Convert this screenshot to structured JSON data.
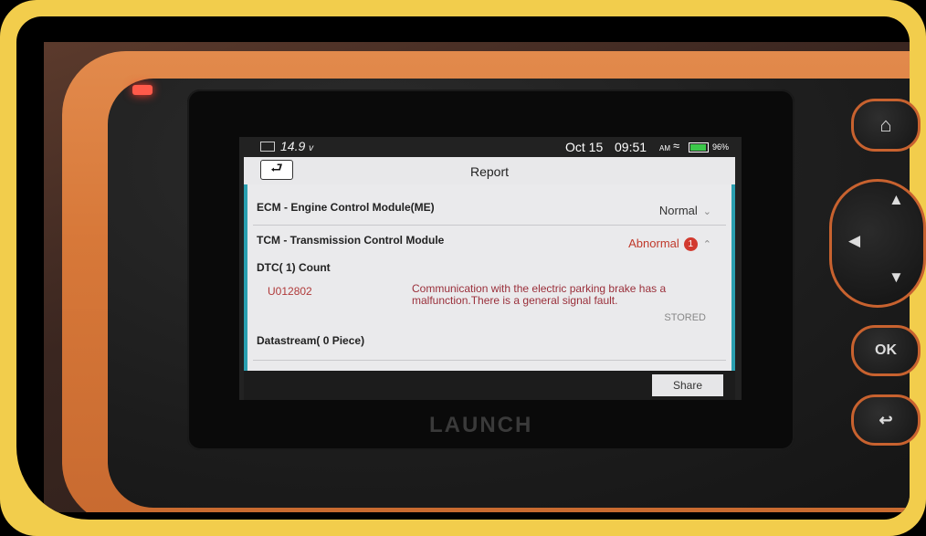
{
  "status_bar": {
    "voltage": "14.9",
    "voltage_unit": "v",
    "date": "Oct 15",
    "time": "09:51",
    "ampm": "AM",
    "battery": "96%"
  },
  "header": {
    "back_icon": "back-arrow-icon",
    "title": "Report"
  },
  "modules": [
    {
      "name": "ECM - Engine Control Module(ME)",
      "status": "Normal"
    },
    {
      "name": "TCM - Transmission Control Module",
      "status": "Abnormal",
      "badge": "1"
    }
  ],
  "dtc": {
    "count_label": "DTC( 1) Count",
    "code": "U012802",
    "description": "Communication with the electric parking brake has a malfunction.There is a general signal fault.",
    "state": "STORED"
  },
  "datastream": {
    "label": "Datastream( 0 Piece)"
  },
  "footer": {
    "share_label": "Share"
  },
  "device": {
    "brand": "LAUNCH",
    "ok_label": "OK"
  },
  "colors": {
    "frame": "#f2cd4c",
    "device": "#d77839",
    "accent": "#2a9fb0",
    "abnormal": "#c0392b"
  }
}
